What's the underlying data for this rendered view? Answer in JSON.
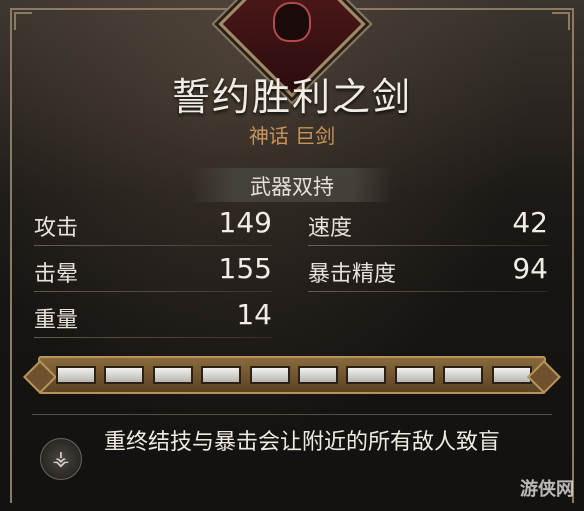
{
  "item": {
    "name": "誓约胜利之剑",
    "rarity_type": "神话 巨剑",
    "tag": "武器双持"
  },
  "stats": [
    {
      "label": "攻击",
      "value": "149"
    },
    {
      "label": "速度",
      "value": "42"
    },
    {
      "label": "击晕",
      "value": "155"
    },
    {
      "label": "暴击精度",
      "value": "94"
    },
    {
      "label": "重量",
      "value": "14"
    }
  ],
  "upgrade_slots": {
    "filled": 10,
    "total": 10
  },
  "perk": {
    "icon": "perk-rune-icon",
    "description": "重终结技与暴击会让附近的所有敌人致盲"
  },
  "watermark": "游侠网",
  "colors": {
    "title": "#f2ede4",
    "rarity": "#c9935a",
    "emblem": "#5a1c1e",
    "slot_bar": "#8a6a3c"
  }
}
